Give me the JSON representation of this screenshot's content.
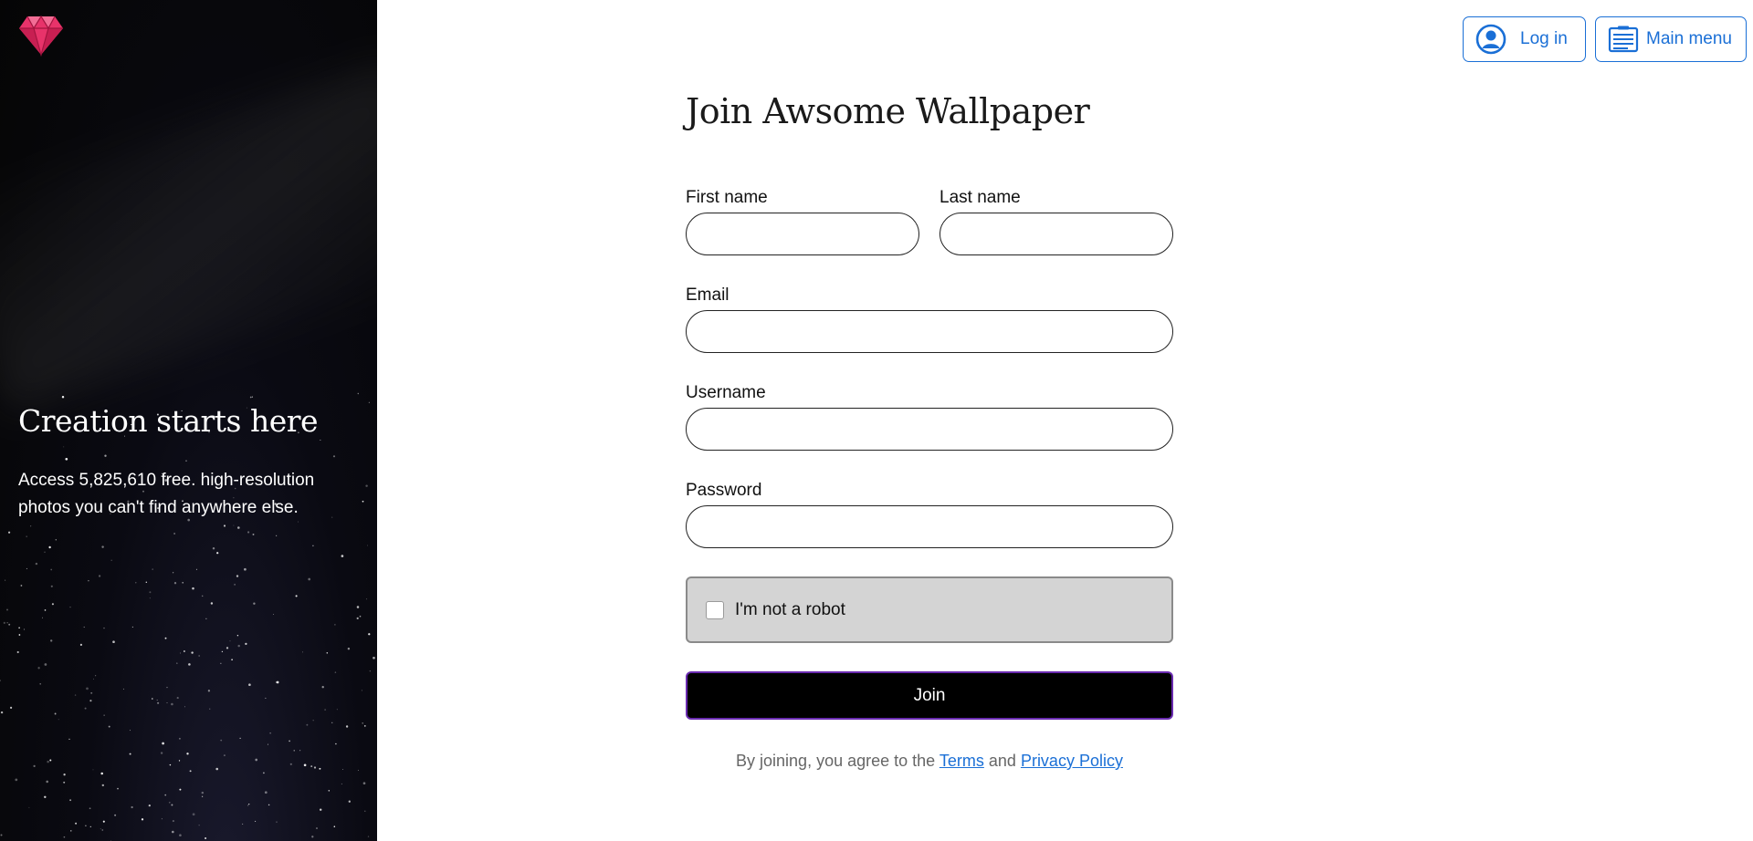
{
  "brand": {
    "logo_icon": "diamond-icon",
    "logo_color": "#e8336a"
  },
  "left_panel": {
    "heading": "Creation starts here",
    "subtext": "Access 5,825,610 free. high-resolution photos you can't find anywhere else."
  },
  "header": {
    "login_label": "Log in",
    "login_icon": "user-circle-icon",
    "menu_label": "Main menu",
    "menu_icon": "menu-list-icon",
    "accent_color": "#1a6fd6"
  },
  "form": {
    "title": "Join Awsome Wallpaper",
    "first_name": {
      "label": "First name",
      "value": ""
    },
    "last_name": {
      "label": "Last name",
      "value": ""
    },
    "email": {
      "label": "Email",
      "value": ""
    },
    "username": {
      "label": "Username",
      "value": ""
    },
    "password": {
      "label": "Password",
      "value": ""
    },
    "captcha_label": "I'm not a robot",
    "captcha_checked": false,
    "join_label": "Join",
    "join_border_color": "#6a2bb0"
  },
  "legal": {
    "prefix": "By joining, you agree to the",
    "terms": "Terms",
    "and": "and",
    "privacy": "Privacy Policy"
  }
}
